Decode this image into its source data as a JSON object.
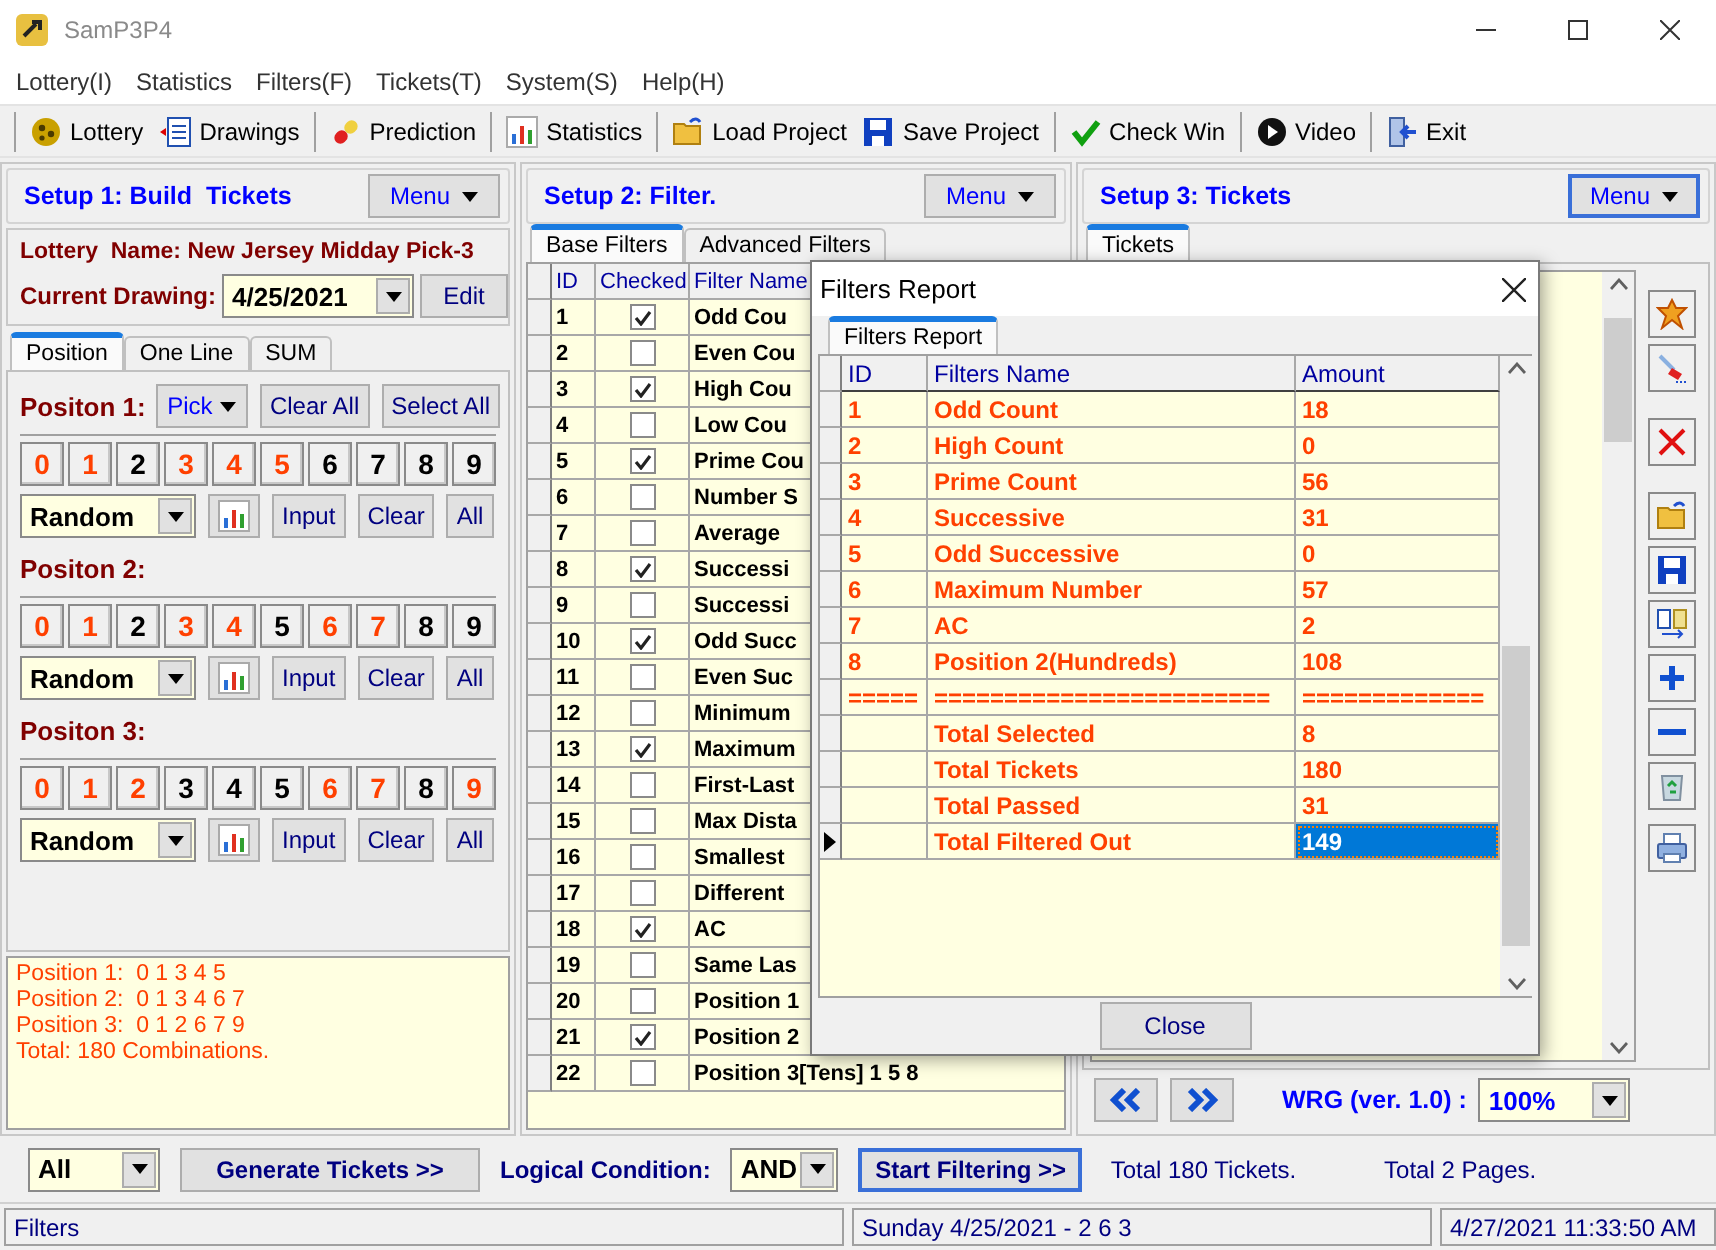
{
  "window": {
    "title": "SamP3P4"
  },
  "menu": [
    "Lottery(I)",
    "Statistics",
    "Filters(F)",
    "Tickets(T)",
    "System(S)",
    "Help(H)"
  ],
  "toolbar": [
    [
      {
        "label": "Lottery"
      },
      {
        "label": "Drawings"
      }
    ],
    [
      {
        "label": "Prediction"
      }
    ],
    [
      {
        "label": "Statistics"
      }
    ],
    [
      {
        "label": "Load Project"
      },
      {
        "label": "Save Project"
      }
    ],
    [
      {
        "label": "Check Win"
      }
    ],
    [
      {
        "label": "Video"
      }
    ],
    [
      {
        "label": "Exit"
      }
    ]
  ],
  "setup1": {
    "title": "Setup 1: Build  Tickets",
    "menu": {
      "label": "Menu",
      "focused": false
    },
    "lottery_name": "Lottery  Name: New Jersey Midday Pick-3",
    "drawing_label": "Current Drawing:",
    "drawing": "4/25/2021",
    "edit": "Edit",
    "tabs": [
      {
        "label": "Position",
        "selected": true
      },
      {
        "label": "One Line",
        "selected": false
      },
      {
        "label": "SUM",
        "selected": false
      }
    ],
    "positions": [
      {
        "label": "Positon 1:",
        "actions": [
          {
            "label": "Pick",
            "kind": "dropdown"
          },
          {
            "label": "Clear All",
            "kind": "button"
          },
          {
            "label": "Select All",
            "kind": "button"
          }
        ],
        "digits": [
          {
            "label": "0",
            "selected": true
          },
          {
            "label": "1",
            "selected": true
          },
          {
            "label": "2",
            "selected": false
          },
          {
            "label": "3",
            "selected": true
          },
          {
            "label": "4",
            "selected": true
          },
          {
            "label": "5",
            "selected": true
          },
          {
            "label": "6",
            "selected": false
          },
          {
            "label": "7",
            "selected": false
          },
          {
            "label": "8",
            "selected": false
          },
          {
            "label": "9",
            "selected": false
          }
        ],
        "mode": "Random",
        "buttons": [
          "Input",
          "Clear",
          "All"
        ]
      },
      {
        "label": "Positon 2:",
        "digits": [
          {
            "label": "0",
            "selected": true
          },
          {
            "label": "1",
            "selected": true
          },
          {
            "label": "2",
            "selected": false
          },
          {
            "label": "3",
            "selected": true
          },
          {
            "label": "4",
            "selected": true
          },
          {
            "label": "5",
            "selected": false
          },
          {
            "label": "6",
            "selected": true
          },
          {
            "label": "7",
            "selected": true
          },
          {
            "label": "8",
            "selected": false
          },
          {
            "label": "9",
            "selected": false
          }
        ],
        "mode": "Random",
        "buttons": [
          "Input",
          "Clear",
          "All"
        ]
      },
      {
        "label": "Positon 3:",
        "digits": [
          {
            "label": "0",
            "selected": true
          },
          {
            "label": "1",
            "selected": true
          },
          {
            "label": "2",
            "selected": true
          },
          {
            "label": "3",
            "selected": false
          },
          {
            "label": "4",
            "selected": false
          },
          {
            "label": "5",
            "selected": false
          },
          {
            "label": "6",
            "selected": true
          },
          {
            "label": "7",
            "selected": true
          },
          {
            "label": "8",
            "selected": false
          },
          {
            "label": "9",
            "selected": true
          }
        ],
        "mode": "Random",
        "buttons": [
          "Input",
          "Clear",
          "All"
        ]
      }
    ],
    "summary": [
      "Position 1:  0 1 3 4 5",
      "Position 2:  0 1 3 4 6 7",
      "Position 3:  0 1 2 6 7 9",
      "Total: 180 Combinations."
    ]
  },
  "setup2": {
    "title": "Setup 2: Filter.",
    "menu": {
      "label": "Menu",
      "focused": false
    },
    "tabs": [
      {
        "label": "Base Filters",
        "selected": true
      },
      {
        "label": "Advanced Filters",
        "selected": false
      }
    ],
    "columns": [
      "ID",
      "Checked",
      "Filter Name"
    ],
    "rows": [
      {
        "id": "1",
        "checked": true,
        "name": "Odd Cou"
      },
      {
        "id": "2",
        "checked": false,
        "name": "Even Cou"
      },
      {
        "id": "3",
        "checked": true,
        "name": "High Cou"
      },
      {
        "id": "4",
        "checked": false,
        "name": "Low Cou"
      },
      {
        "id": "5",
        "checked": true,
        "name": "Prime Cou"
      },
      {
        "id": "6",
        "checked": false,
        "name": "Number S"
      },
      {
        "id": "7",
        "checked": false,
        "name": "Average"
      },
      {
        "id": "8",
        "checked": true,
        "name": "Successi"
      },
      {
        "id": "9",
        "checked": false,
        "name": "Successi"
      },
      {
        "id": "10",
        "checked": true,
        "name": "Odd Succ"
      },
      {
        "id": "11",
        "checked": false,
        "name": "Even Suc"
      },
      {
        "id": "12",
        "checked": false,
        "name": "Minimum"
      },
      {
        "id": "13",
        "checked": true,
        "name": "Maximum"
      },
      {
        "id": "14",
        "checked": false,
        "name": "First-Last"
      },
      {
        "id": "15",
        "checked": false,
        "name": "Max Dista"
      },
      {
        "id": "16",
        "checked": false,
        "name": "Smallest"
      },
      {
        "id": "17",
        "checked": false,
        "name": "Different"
      },
      {
        "id": "18",
        "checked": true,
        "name": "AC"
      },
      {
        "id": "19",
        "checked": false,
        "name": "Same Las"
      },
      {
        "id": "20",
        "checked": false,
        "name": "Position 1"
      },
      {
        "id": "21",
        "checked": true,
        "name": "Position 2"
      },
      {
        "id": "22",
        "checked": false,
        "name": "Position 3[Tens] 1 5 8"
      }
    ]
  },
  "setup3": {
    "title": "Setup 3: Tickets",
    "menu": {
      "label": "Menu",
      "focused": true
    },
    "tabs": [
      {
        "label": "Tickets",
        "selected": true
      }
    ],
    "version_label": "WRG (ver. 1.0) :",
    "zoom": "100%"
  },
  "bottom": {
    "scope": "All",
    "generate": "Generate Tickets >>",
    "condition_label": "Logical Condition:",
    "condition": "AND",
    "start": "Start Filtering >>",
    "tickets_total": "Total 180 Tickets.",
    "pages_total": "Total 2 Pages."
  },
  "status_bar": [
    "Filters",
    "Sunday 4/25/2021 - 2 6 3",
    "4/27/2021 11:33:50 AM"
  ],
  "dialog": {
    "title": "Filters Report",
    "tab": "Filters Report",
    "columns": [
      "ID",
      "Filters Name",
      "Amount"
    ],
    "rows": [
      {
        "id": "1",
        "name": "Odd Count",
        "amount": "18",
        "selected": false
      },
      {
        "id": "2",
        "name": "High Count",
        "amount": "0",
        "selected": false
      },
      {
        "id": "3",
        "name": "Prime Count",
        "amount": "56",
        "selected": false
      },
      {
        "id": "4",
        "name": "Successive",
        "amount": "31",
        "selected": false
      },
      {
        "id": "5",
        "name": "Odd Successive",
        "amount": "0",
        "selected": false
      },
      {
        "id": "6",
        "name": "Maximum Number",
        "amount": "57",
        "selected": false
      },
      {
        "id": "7",
        "name": "AC",
        "amount": "2",
        "selected": false
      },
      {
        "id": "8",
        "name": "Position 2(Hundreds)",
        "amount": "108",
        "selected": false
      },
      {
        "id": "=====",
        "name": "========================",
        "amount": "=============",
        "selected": false
      },
      {
        "name": "Total Selected",
        "amount": "8",
        "selected": false
      },
      {
        "name": "Total Tickets",
        "amount": "180",
        "selected": false
      },
      {
        "name": "Total Passed",
        "amount": "31",
        "selected": false
      },
      {
        "name": "Total Filtered Out",
        "amount": "149",
        "selected": true
      }
    ],
    "close": "Close"
  }
}
